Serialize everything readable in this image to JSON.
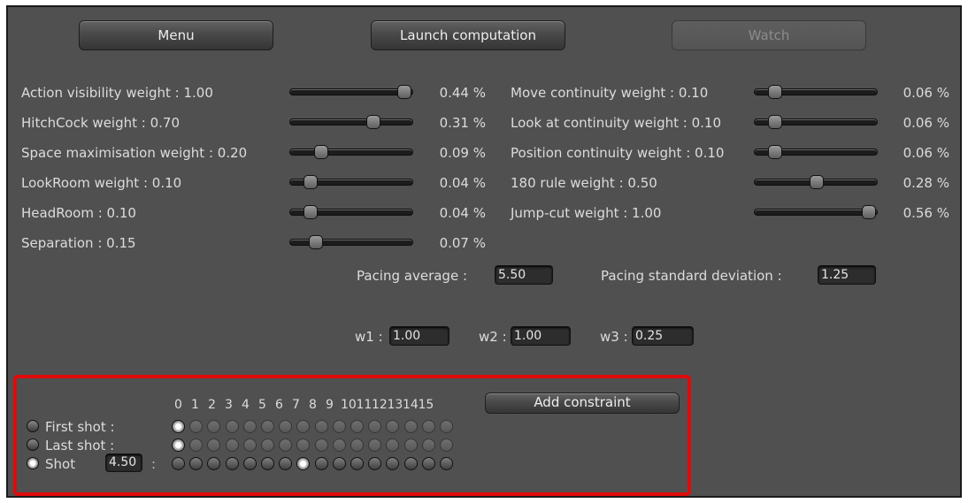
{
  "toolbar": {
    "menu_label": "Menu",
    "launch_label": "Launch computation",
    "watch_label": "Watch"
  },
  "left_sliders": [
    {
      "label": "Action visibility weight : 1.00",
      "value": 1.0,
      "percent": "0.44 %"
    },
    {
      "label": "HitchCock weight : 0.70",
      "value": 0.7,
      "percent": "0.31 %"
    },
    {
      "label": "Space maximisation weight : 0.20",
      "value": 0.2,
      "percent": "0.09 %"
    },
    {
      "label": "LookRoom weight : 0.10",
      "value": 0.1,
      "percent": "0.04 %"
    },
    {
      "label": "HeadRoom : 0.10",
      "value": 0.1,
      "percent": "0.04 %"
    },
    {
      "label": "Separation : 0.15",
      "value": 0.15,
      "percent": "0.07 %"
    }
  ],
  "right_sliders": [
    {
      "label": "Move continuity weight : 0.10",
      "value": 0.1,
      "percent": "0.06 %"
    },
    {
      "label": "Look at continuity weight : 0.10",
      "value": 0.1,
      "percent": "0.06 %"
    },
    {
      "label": "Position continuity weight : 0.10",
      "value": 0.1,
      "percent": "0.06 %"
    },
    {
      "label": "180 rule weight : 0.50",
      "value": 0.5,
      "percent": "0.28 %"
    },
    {
      "label": "Jump-cut weight : 1.00",
      "value": 1.0,
      "percent": "0.56 %"
    }
  ],
  "pacing": {
    "average_label": "Pacing average :",
    "average_value": "5.50",
    "std_label": "Pacing standard deviation :",
    "std_value": "1.25"
  },
  "weights": {
    "w1_label": "w1 :",
    "w1_value": "1.00",
    "w2_label": "w2 :",
    "w2_value": "1.00",
    "w3_label": "w3 :",
    "w3_value": "0.25"
  },
  "constraints": {
    "indices": [
      "0",
      "1",
      "2",
      "3",
      "4",
      "5",
      "6",
      "7",
      "8",
      "9",
      "10",
      "11",
      "12",
      "13",
      "14",
      "15"
    ],
    "add_label": "Add constraint",
    "rows": [
      {
        "label": "First shot :",
        "selected": false,
        "dim": true,
        "active_index": 0
      },
      {
        "label": "Last shot :",
        "selected": false,
        "dim": true,
        "active_index": 0
      },
      {
        "label": "Shot",
        "selected": true,
        "dim": false,
        "active_index": 7,
        "value": "4.50",
        "suffix": ":"
      }
    ]
  },
  "colors": {
    "panel_bg": "#505050",
    "highlight_border": "#e10a0a"
  }
}
